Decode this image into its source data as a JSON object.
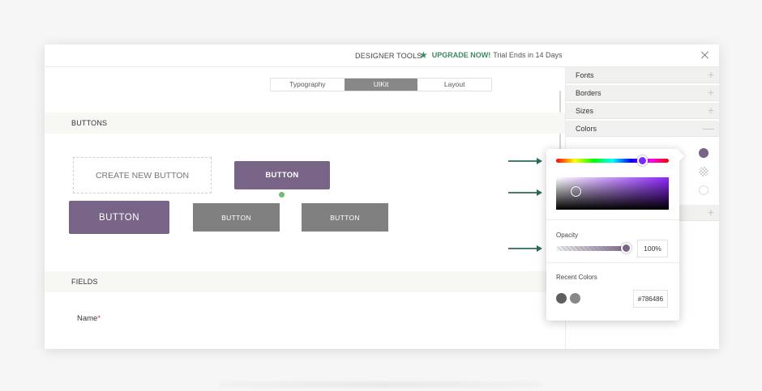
{
  "topbar": {
    "title": "DESIGNER TOOLS",
    "upgrade_label": "UPGRADE NOW!",
    "trial_text": "Trial Ends in 14 Days"
  },
  "tabs": [
    {
      "label": "Typography",
      "active": false
    },
    {
      "label": "UIKit",
      "active": true
    },
    {
      "label": "Layout",
      "active": false
    }
  ],
  "sections": {
    "buttons_title": "BUTTONS",
    "fields_title": "FIELDS"
  },
  "buttons": {
    "create_new": "CREATE NEW BUTTON",
    "purple_small": "BUTTON",
    "purple_large": "BUTTON",
    "gray_1": "BUTTON",
    "gray_2": "BUTTON"
  },
  "fields": {
    "name_label": "Name",
    "required_mark": "*"
  },
  "sidepanel": {
    "rows": [
      {
        "label": "Fonts",
        "sign": "+"
      },
      {
        "label": "Borders",
        "sign": "+"
      },
      {
        "label": "Sizes",
        "sign": "+"
      },
      {
        "label": "Colors",
        "sign": "—"
      },
      {
        "label": "",
        "sign": "+"
      }
    ]
  },
  "picker": {
    "opacity_label": "Opacity",
    "opacity_value": "100%",
    "recent_label": "Recent Colors",
    "hex_value": "#786486",
    "recent_colors": [
      "#5f5f5f",
      "#888888"
    ]
  },
  "colors": {
    "accent_purple": "#786486",
    "gray_button": "#808080",
    "upgrade_green": "#3d8a62",
    "arrow_green": "#2c6b4f",
    "required_red": "#d9343c"
  }
}
